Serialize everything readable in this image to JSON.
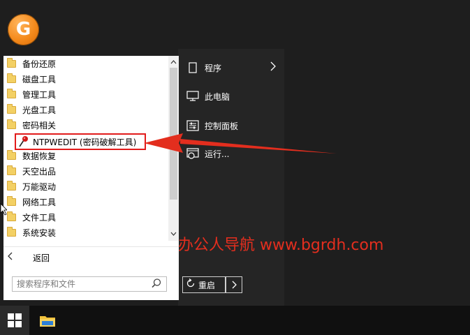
{
  "desktop": {
    "logo_letter": "G"
  },
  "programs": {
    "items": [
      {
        "label": "备份还原"
      },
      {
        "label": "磁盘工具"
      },
      {
        "label": "管理工具"
      },
      {
        "label": "光盘工具"
      },
      {
        "label": "密码相关"
      },
      {
        "label": "数据恢复"
      },
      {
        "label": "天空出品"
      },
      {
        "label": "万能驱动"
      },
      {
        "label": "网络工具"
      },
      {
        "label": "文件工具"
      },
      {
        "label": "系统安装"
      }
    ],
    "highlighted_item": {
      "label": "NTPWEDIT (密码破解工具)",
      "icon": "pin-key-icon"
    },
    "back_label": "返回",
    "search_placeholder": "搜索程序和文件"
  },
  "right_menu": {
    "programs_label": "程序",
    "computer_label": "此电脑",
    "control_panel_label": "控制面板",
    "run_label": "运行...",
    "restart_label": "重启"
  },
  "annotation": {
    "watermark": "办公人导航 www.bgrdh.com",
    "highlight_color": "#e21b1b"
  },
  "colors": {
    "desktop_bg": "#1e1e1e",
    "menu_dark": "#252525",
    "taskbar": "#101010",
    "accent_orange": "#f48a1c"
  }
}
